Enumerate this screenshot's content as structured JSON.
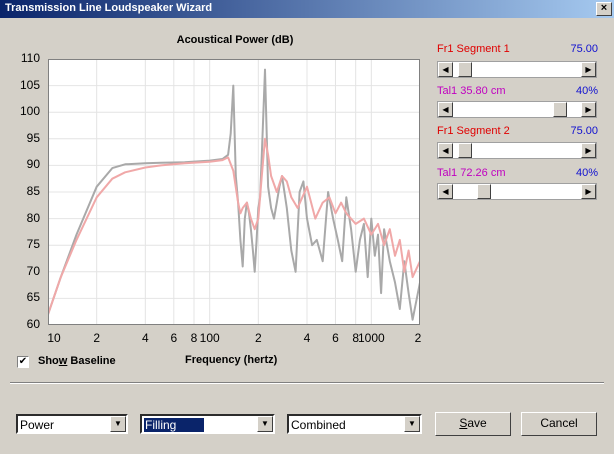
{
  "window": {
    "title": "Transmission Line Loudspeaker Wizard",
    "close_glyph": "×"
  },
  "chart_data": {
    "type": "line",
    "title": "Acoustical Power (dB)",
    "xlabel": "Frequency (hertz)",
    "ylabel": "",
    "xscale": "log",
    "xlim": [
      10,
      2000
    ],
    "ylim": [
      60,
      110
    ],
    "grid": true,
    "yticks": [
      "60",
      "65",
      "70",
      "75",
      "80",
      "85",
      "90",
      "95",
      "100",
      "105",
      "110"
    ],
    "xtick_values": [
      10,
      20,
      40,
      60,
      80,
      100,
      200,
      400,
      600,
      800,
      1000,
      2000
    ],
    "xticks": [
      "10",
      "2",
      "4",
      "6",
      "8",
      "100",
      "2",
      "4",
      "6",
      "8",
      "1000",
      "2"
    ],
    "series": [
      {
        "color": "#a9a9a9",
        "x": [
          10,
          12,
          15,
          20,
          25,
          30,
          40,
          50,
          70,
          100,
          120,
          130,
          135,
          140,
          145,
          150,
          155,
          160,
          165,
          170,
          175,
          180,
          185,
          190,
          195,
          200,
          205,
          210,
          215,
          220,
          230,
          240,
          250,
          260,
          270,
          280,
          290,
          300,
          320,
          340,
          360,
          380,
          400,
          430,
          460,
          500,
          540,
          580,
          620,
          660,
          700,
          750,
          800,
          850,
          900,
          950,
          1000,
          1050,
          1100,
          1150,
          1200,
          1300,
          1400,
          1500,
          1600,
          1700,
          1800,
          2000
        ],
        "y": [
          62,
          69,
          77,
          86,
          89.5,
          90.2,
          90.4,
          90.5,
          90.6,
          90.9,
          91.2,
          92,
          96,
          105,
          88,
          83,
          76,
          71,
          80,
          83,
          81,
          78,
          74,
          70,
          76,
          82,
          84,
          92,
          100,
          108,
          86,
          82,
          80,
          83,
          86,
          88,
          85,
          82,
          74,
          70,
          85,
          87,
          80,
          75,
          76,
          72,
          85,
          80,
          76,
          72,
          84,
          78,
          70,
          76,
          79,
          69,
          80,
          73,
          77,
          66,
          78,
          72,
          68,
          63,
          72,
          66,
          61,
          68
        ]
      },
      {
        "color": "#f0a8a8",
        "x": [
          10,
          12,
          15,
          20,
          25,
          30,
          40,
          50,
          70,
          100,
          120,
          130,
          140,
          150,
          155,
          160,
          170,
          180,
          190,
          200,
          210,
          220,
          230,
          240,
          260,
          280,
          300,
          320,
          350,
          400,
          450,
          500,
          550,
          600,
          650,
          700,
          800,
          900,
          1000,
          1100,
          1200,
          1300,
          1400,
          1500,
          1600,
          1700,
          1800,
          2000
        ],
        "y": [
          62,
          69,
          76,
          84,
          87.5,
          88.7,
          89.6,
          90,
          90.4,
          90.7,
          91,
          91.5,
          89,
          83,
          81,
          82,
          83,
          80,
          78,
          80,
          88,
          95,
          92,
          88,
          85,
          88,
          87,
          84,
          82,
          86,
          80,
          83,
          84,
          81,
          83,
          81,
          79,
          80,
          77,
          79,
          75,
          78,
          73,
          76,
          70,
          74,
          69,
          72
        ]
      }
    ]
  },
  "chart_labels": {
    "xaxis": "Frequency (hertz)"
  },
  "baseline": {
    "label": "Show Baseline",
    "checked": true,
    "check_glyph": "✔"
  },
  "segments": [
    {
      "name": "Fr1  Segment 1",
      "value": "75.00",
      "taper_label": "Tal1  35.80 cm",
      "taper_value": "40%",
      "pos": 0.04,
      "taper_pos": 0.88
    },
    {
      "name": "Fr1  Segment 2",
      "value": "75.00",
      "taper_label": "Tal1  72.26 cm",
      "taper_value": "40%",
      "pos": 0.04,
      "taper_pos": 0.21
    }
  ],
  "scroll": {
    "left_glyph": "◀",
    "right_glyph": "▶"
  },
  "dropdowns": {
    "mode": {
      "value": "Power",
      "arrow": "▼"
    },
    "filling": {
      "value": "Filling",
      "arrow": "▼"
    },
    "view": {
      "value": "Combined",
      "arrow": "▼"
    }
  },
  "buttons": {
    "save": "ave",
    "save_mnemonic": "S",
    "cancel": "Cancel"
  }
}
